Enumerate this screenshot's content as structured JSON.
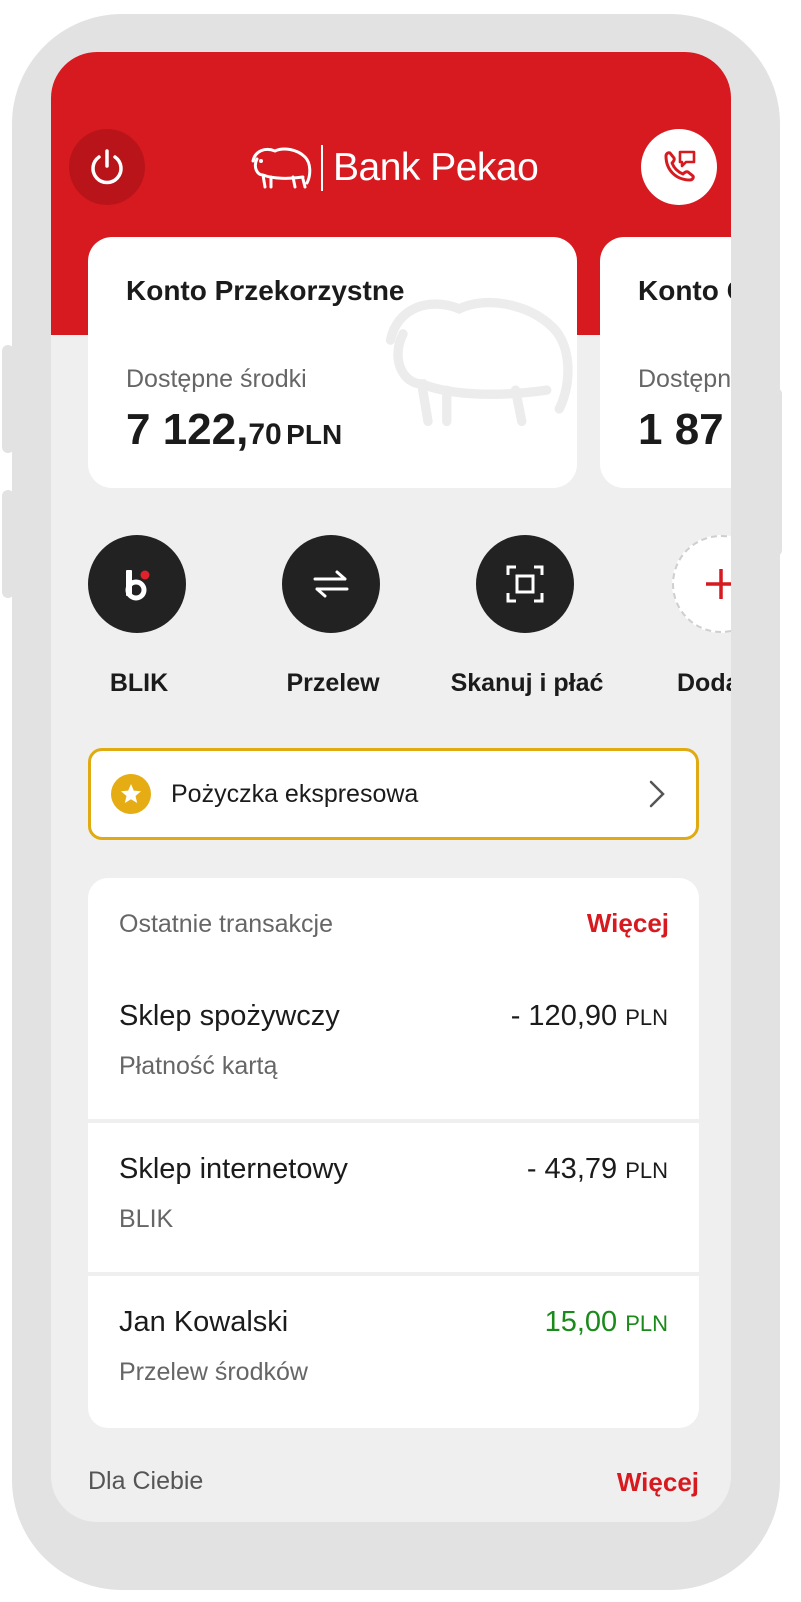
{
  "brand": {
    "name": "Bank Pekao",
    "accent": "#d71920"
  },
  "accounts": [
    {
      "title": "Konto Przekorzystne",
      "balance_label": "Dostępne środki",
      "balance_int": "7 122,",
      "balance_dec": "70",
      "currency": "PLN"
    },
    {
      "title": "Konto C",
      "balance_label": "Dostępn",
      "balance_int": "1 87",
      "balance_dec": "",
      "currency": ""
    }
  ],
  "quick_actions": [
    {
      "label": "BLIK",
      "icon": "blik-icon"
    },
    {
      "label": "Przelew",
      "icon": "transfer-arrows-icon"
    },
    {
      "label": "Skanuj i płać",
      "icon": "scan-icon"
    },
    {
      "label": "Dodaj s",
      "icon": "plus-icon"
    }
  ],
  "loan_banner": {
    "label": "Pożyczka ekspresowa",
    "icon": "star-icon",
    "color": "#e0ab12"
  },
  "transactions": {
    "header": "Ostatnie transakcje",
    "more": "Więcej",
    "items": [
      {
        "name": "Sklep spożywczy",
        "subtitle": "Płatność kartą",
        "amount": "- 120,90",
        "currency": "PLN",
        "positive": false
      },
      {
        "name": "Sklep internetowy",
        "subtitle": "BLIK",
        "amount": "- 43,79",
        "currency": "PLN",
        "positive": false
      },
      {
        "name": "Jan Kowalski",
        "subtitle": "Przelew środków",
        "amount": "15,00",
        "currency": "PLN",
        "positive": true
      }
    ]
  },
  "for_you": {
    "title": "Dla Ciebie",
    "more": "Więcej"
  }
}
